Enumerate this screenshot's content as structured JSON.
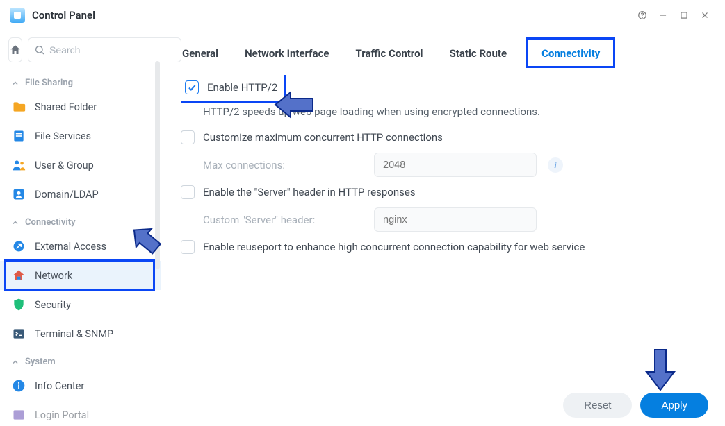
{
  "window": {
    "title": "Control Panel"
  },
  "search": {
    "placeholder": "Search"
  },
  "groups": {
    "file_sharing": {
      "label": "File Sharing",
      "items": [
        {
          "label": "Shared Folder"
        },
        {
          "label": "File Services"
        },
        {
          "label": "User & Group"
        },
        {
          "label": "Domain/LDAP"
        }
      ]
    },
    "connectivity": {
      "label": "Connectivity",
      "items": [
        {
          "label": "External Access"
        },
        {
          "label": "Network"
        },
        {
          "label": "Security"
        },
        {
          "label": "Terminal & SNMP"
        }
      ]
    },
    "system": {
      "label": "System",
      "items": [
        {
          "label": "Info Center"
        },
        {
          "label": "Login Portal"
        }
      ]
    }
  },
  "tabs": {
    "general": "General",
    "network_interface": "Network Interface",
    "traffic_control": "Traffic Control",
    "static_route": "Static Route",
    "connectivity": "Connectivity"
  },
  "form": {
    "enable_http2_label": "Enable HTTP/2",
    "enable_http2_desc": "HTTP/2 speeds up web page loading when using encrypted connections.",
    "customize_max_label": "Customize maximum concurrent HTTP connections",
    "max_conn_label": "Max connections:",
    "max_conn_value": "2048",
    "server_header_label": "Enable the \"Server\" header in HTTP responses",
    "custom_server_label": "Custom \"Server\" header:",
    "custom_server_value": "nginx",
    "reuseport_label": "Enable reuseport to enhance high concurrent connection capability for web service"
  },
  "buttons": {
    "reset": "Reset",
    "apply": "Apply"
  }
}
